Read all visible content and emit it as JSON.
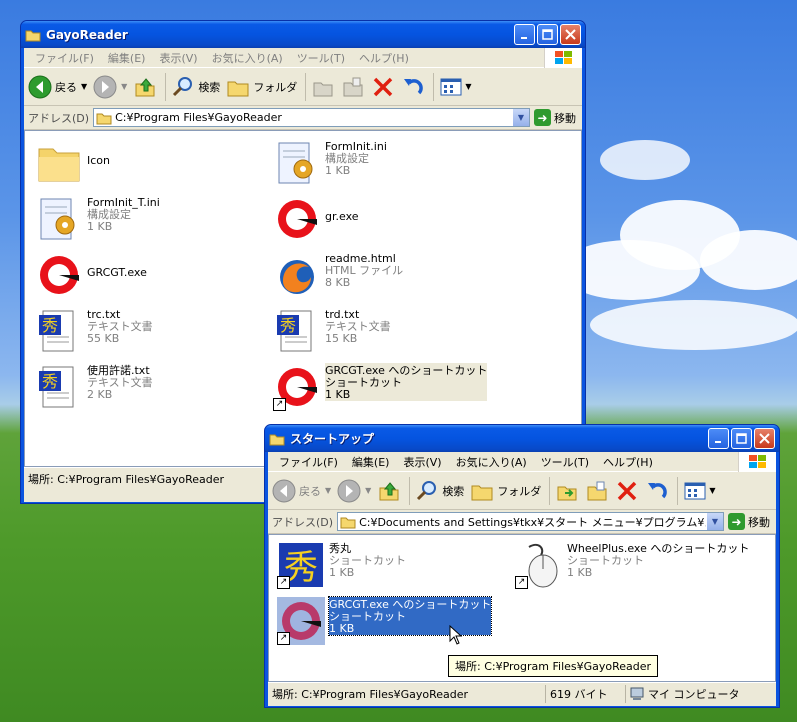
{
  "win1": {
    "title": "GayoReader",
    "menu": [
      "ファイル(F)",
      "編集(E)",
      "表示(V)",
      "お気に入り(A)",
      "ツール(T)",
      "ヘルプ(H)"
    ],
    "toolbar": {
      "back": "戻る",
      "search": "検索",
      "folders": "フォルダ"
    },
    "address_label": "アドレス(D)",
    "address": "C:¥Program Files¥GayoReader",
    "go_label": "移動",
    "files": [
      {
        "name": "Icon",
        "type": "",
        "size": "",
        "icon": "folder-icon"
      },
      {
        "name": "FormInit.ini",
        "type": "構成設定",
        "size": "1 KB",
        "icon": "ini-file-icon"
      },
      {
        "name": "FormInit_T.ini",
        "type": "構成設定",
        "size": "1 KB",
        "icon": "ini-file-icon"
      },
      {
        "name": "gr.exe",
        "type": "",
        "size": "",
        "icon": "gayo-app-icon"
      },
      {
        "name": "GRCGT.exe",
        "type": "",
        "size": "",
        "icon": "gayo-app-icon"
      },
      {
        "name": "readme.html",
        "type": "HTML ファイル",
        "size": "8 KB",
        "icon": "firefox-icon"
      },
      {
        "name": "trc.txt",
        "type": "テキスト文書",
        "size": "55 KB",
        "icon": "hidemaru-text-icon"
      },
      {
        "name": "trd.txt",
        "type": "テキスト文書",
        "size": "15 KB",
        "icon": "hidemaru-text-icon"
      },
      {
        "name": "使用許諾.txt",
        "type": "テキスト文書",
        "size": "2 KB",
        "icon": "hidemaru-text-icon"
      },
      {
        "name": "GRCGT.exe へのショートカット",
        "type": "ショートカット",
        "size": "1 KB",
        "icon": "gayo-app-icon"
      }
    ],
    "status": "場所: C:¥Program Files¥GayoReader"
  },
  "win2": {
    "title": "スタートアップ",
    "menu": [
      "ファイル(F)",
      "編集(E)",
      "表示(V)",
      "お気に入り(A)",
      "ツール(T)",
      "ヘルプ(H)"
    ],
    "toolbar": {
      "back": "戻る",
      "search": "検索",
      "folders": "フォルダ"
    },
    "address_label": "アドレス(D)",
    "address": "C:¥Documents and Settings¥tkx¥スタート メニュー¥プログラム¥スタートアップ",
    "go_label": "移動",
    "files": [
      {
        "name": "秀丸",
        "type": "ショートカット",
        "size": "1 KB",
        "icon": "hidemaru-icon"
      },
      {
        "name": "WheelPlus.exe へのショートカット",
        "type": "ショートカット",
        "size": "1 KB",
        "icon": "mouse-icon"
      },
      {
        "name": "GRCGT.exe へのショートカット",
        "type": "ショートカット",
        "size": "1 KB",
        "icon": "gayo-app-icon"
      }
    ],
    "status": "場所: C:¥Program Files¥GayoReader",
    "status_size": "619 バイト",
    "status_zone": "マイ コンピュータ"
  },
  "tooltip": "場所: C:¥Program Files¥GayoReader",
  "colors": {
    "xp_title_blue": "#0a54e0",
    "selection": "#316ac5",
    "chrome": "#ece9d8"
  }
}
